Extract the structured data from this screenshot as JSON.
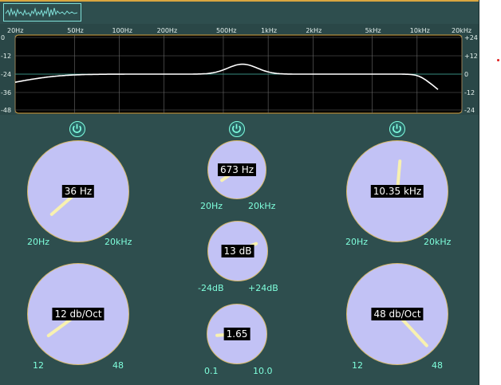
{
  "graph": {
    "freq_labels": [
      "20Hz",
      "50Hz",
      "100Hz",
      "200Hz",
      "500Hz",
      "1kHz",
      "2kHz",
      "5kHz",
      "10kHz",
      "20kHz"
    ],
    "left_db_labels": [
      "0",
      "-12",
      "-24",
      "-36",
      "-48"
    ],
    "right_db_labels": [
      "+24",
      "+12",
      "0",
      "-12",
      "-24"
    ]
  },
  "bands": {
    "highpass": {
      "power": "on",
      "freq": {
        "display": "36 Hz",
        "min_label": "20Hz",
        "max_label": "20kHz",
        "value_fraction": 0.09
      },
      "slope": {
        "display": "12 db/Oct",
        "min_label": "12",
        "max_label": "48",
        "value_fraction": 0.0
      }
    },
    "peak": {
      "power": "on",
      "freq": {
        "display": "673 Hz",
        "min_label": "20Hz",
        "max_label": "20kHz",
        "value_fraction": 0.09
      },
      "gain": {
        "display": "13 dB",
        "min_label": "-24dB",
        "max_label": "+24dB",
        "value_fraction": 0.77
      },
      "q": {
        "display": "1.65",
        "min_label": "0.1",
        "max_label": "10.0",
        "value_fraction": 0.03
      }
    },
    "lowpass": {
      "power": "on",
      "freq": {
        "display": "10.35 kHz",
        "min_label": "20Hz",
        "max_label": "20kHz",
        "value_fraction": 0.51
      },
      "slope": {
        "display": "48 db/Oct",
        "min_label": "12",
        "max_label": "48",
        "value_fraction": 1.0
      }
    }
  },
  "icons": {
    "power": "power-icon",
    "scope": "waveform-icon"
  },
  "colors": {
    "panel_bg": "#2e4e4e",
    "knob_face": "#c2c2f5",
    "knob_ring": "#d7b96a",
    "needle": "#f8f1b0",
    "label": "#7fffdc",
    "curve": "#ffffff",
    "graph_frame": "#d9a640"
  }
}
